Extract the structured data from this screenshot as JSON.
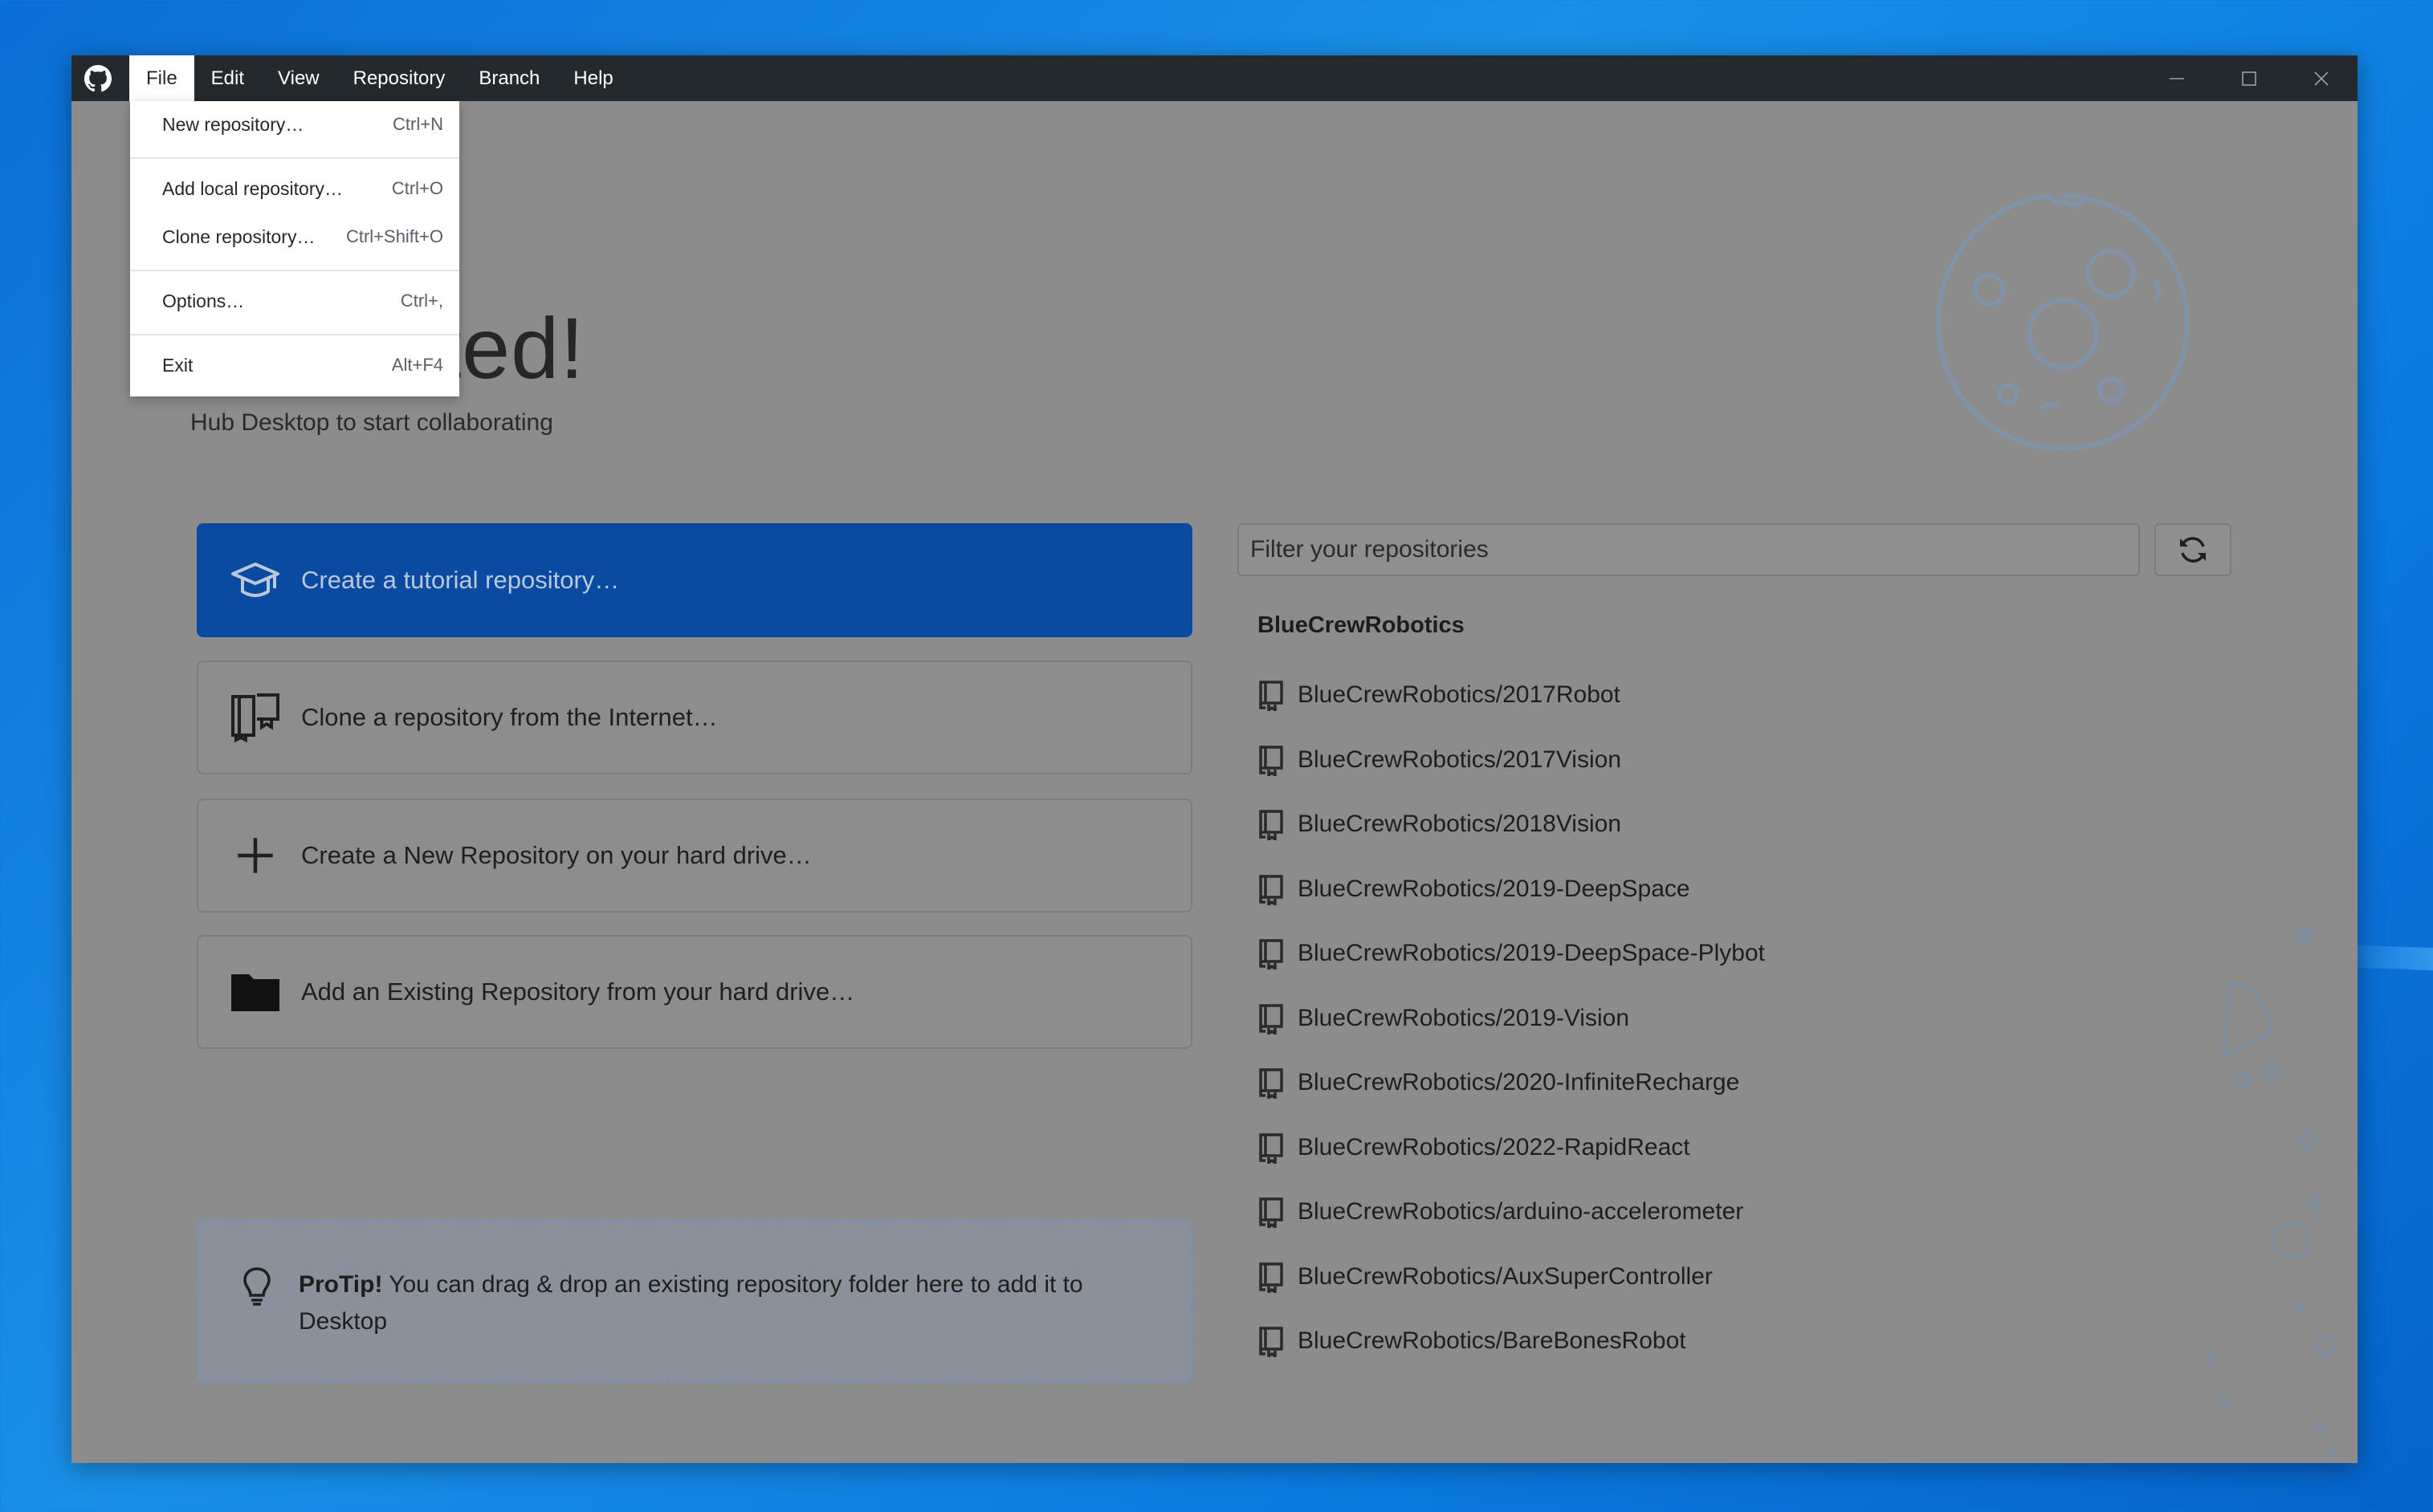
{
  "menubar": {
    "items": [
      "File",
      "Edit",
      "View",
      "Repository",
      "Branch",
      "Help"
    ],
    "active": "File"
  },
  "file_menu": {
    "items": [
      {
        "label": "New repository…",
        "shortcut": "Ctrl+N"
      },
      {
        "label": "Add local repository…",
        "shortcut": "Ctrl+O"
      },
      {
        "label": "Clone repository…",
        "shortcut": "Ctrl+Shift+O"
      },
      {
        "label": "Options…",
        "shortcut": "Ctrl+,"
      },
      {
        "label": "Exit",
        "shortcut": "Alt+F4"
      }
    ]
  },
  "welcome": {
    "title": "et started!",
    "subtitle": "Hub Desktop to start collaborating"
  },
  "actions": {
    "tutorial": "Create a tutorial repository…",
    "clone": "Clone a repository from the Internet…",
    "create": "Create a New Repository on your hard drive…",
    "add_existing": "Add an Existing Repository from your hard drive…"
  },
  "protip": {
    "bold": "ProTip!",
    "text": " You can drag & drop an existing repository folder here to add it to Desktop"
  },
  "repos": {
    "filter_placeholder": "Filter your repositories",
    "group": "BlueCrewRobotics",
    "items": [
      "BlueCrewRobotics/2017Robot",
      "BlueCrewRobotics/2017Vision",
      "BlueCrewRobotics/2018Vision",
      "BlueCrewRobotics/2019-DeepSpace",
      "BlueCrewRobotics/2019-DeepSpace-Plybot",
      "BlueCrewRobotics/2019-Vision",
      "BlueCrewRobotics/2020-InfiniteRecharge",
      "BlueCrewRobotics/2022-RapidReact",
      "BlueCrewRobotics/arduino-accelerometer",
      "BlueCrewRobotics/AuxSuperController",
      "BlueCrewRobotics/BareBonesRobot"
    ]
  },
  "colors": {
    "titlebar": "#24292e",
    "primary_button": "#0a4aa0",
    "desktop": "#0a6fd6"
  },
  "icons": [
    "github-logo-icon",
    "minimize-icon",
    "maximize-icon",
    "close-icon",
    "graduation-cap-icon",
    "clone-book-icon",
    "plus-icon",
    "folder-icon",
    "lightbulb-icon",
    "refresh-icon",
    "repo-icon",
    "moon-illustration"
  ]
}
